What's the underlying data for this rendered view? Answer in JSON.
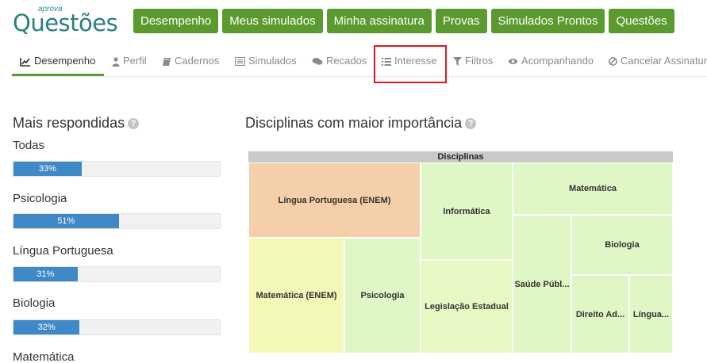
{
  "logo": {
    "small": "aprova",
    "big": "Questões"
  },
  "topnav": [
    "Desempenho",
    "Meus simulados",
    "Minha assinatura",
    "Provas",
    "Simulados Prontos",
    "Questões"
  ],
  "subnav": {
    "items": [
      {
        "label": "Desempenho",
        "icon": "chart-icon"
      },
      {
        "label": "Perfil",
        "icon": "user-icon"
      },
      {
        "label": "Cadernos",
        "icon": "book-icon"
      },
      {
        "label": "Simulados",
        "icon": "list-alt-icon"
      },
      {
        "label": "Recados",
        "icon": "comments-icon"
      },
      {
        "label": "Interesse",
        "icon": "list-icon"
      },
      {
        "label": "Filtros",
        "icon": "filter-icon"
      },
      {
        "label": "Acompanhando",
        "icon": "eye-icon"
      },
      {
        "label": "Cancelar Assinatura",
        "icon": "ban-icon"
      }
    ],
    "active": "Desempenho"
  },
  "mais_respondidas": {
    "title": "Mais respondidas",
    "help": "?",
    "items": [
      {
        "label": "Todas",
        "percent": 33,
        "text": "33%"
      },
      {
        "label": "Psicologia",
        "percent": 51,
        "text": "51%"
      },
      {
        "label": "Língua Portuguesa",
        "percent": 31,
        "text": "31%"
      },
      {
        "label": "Biologia",
        "percent": 32,
        "text": "32%"
      },
      {
        "label": "Matemática",
        "percent": null,
        "text": ""
      }
    ]
  },
  "disciplinas": {
    "title": "Disciplinas com maior importância",
    "help": "?"
  },
  "chart_data": {
    "type": "treemap",
    "title": "Disciplinas",
    "cells": [
      {
        "name": "Língua Portuguesa (ENEM)",
        "color": "#f4cfa9"
      },
      {
        "name": "Informática",
        "color": "#dff7c4"
      },
      {
        "name": "Matemática",
        "color": "#dff7c4"
      },
      {
        "name": "Biologia",
        "color": "#dff7c4"
      },
      {
        "name": "Matemática (ENEM)",
        "color": "#f3f7b8"
      },
      {
        "name": "Psicologia",
        "color": "#dff7c4"
      },
      {
        "name": "Legislação Estadual",
        "color": "#e8f8c2"
      },
      {
        "name": "Saúde Públ...",
        "color": "#dff7c4"
      },
      {
        "name": "Direito Ad...",
        "color": "#dff7c4"
      },
      {
        "name": "Língua...",
        "color": "#dff7c4"
      }
    ]
  },
  "colors": {
    "green": "#5b9a2e",
    "blue": "#3f89c9",
    "red_highlight": "#e0161a",
    "logo": "#2a7f83"
  }
}
